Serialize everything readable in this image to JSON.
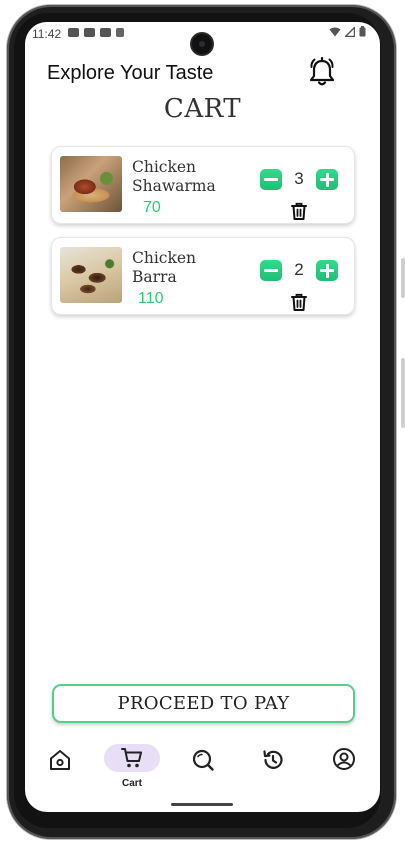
{
  "status_bar": {
    "time": "11:42",
    "left_icons": [
      "youtube-icon",
      "youtube-icon",
      "youtube-icon",
      "sim-card-icon"
    ],
    "right_icons": [
      "wifi-icon",
      "signal-icon",
      "battery-icon"
    ]
  },
  "header": {
    "title": "Explore Your Taste",
    "notification_icon": "bell-icon"
  },
  "page": {
    "heading": "CART"
  },
  "cart": {
    "items": [
      {
        "name": "Chicken Shawarma",
        "price": "70",
        "quantity": "3",
        "image": "shawarma-photo"
      },
      {
        "name": "Chicken Barra",
        "price": "110",
        "quantity": "2",
        "image": "chicken-barra-photo"
      }
    ]
  },
  "actions": {
    "proceed_label": "PROCEED TO PAY"
  },
  "bottom_nav": {
    "items": [
      {
        "icon": "home-icon",
        "label": ""
      },
      {
        "icon": "cart-icon",
        "label": "Cart",
        "active": true
      },
      {
        "icon": "search-icon",
        "label": ""
      },
      {
        "icon": "history-icon",
        "label": ""
      },
      {
        "icon": "profile-icon",
        "label": ""
      }
    ]
  },
  "colors": {
    "accent_green": "#2ecc71",
    "button_green": "#1fbf73",
    "nav_active_pill": "#e8def8"
  }
}
